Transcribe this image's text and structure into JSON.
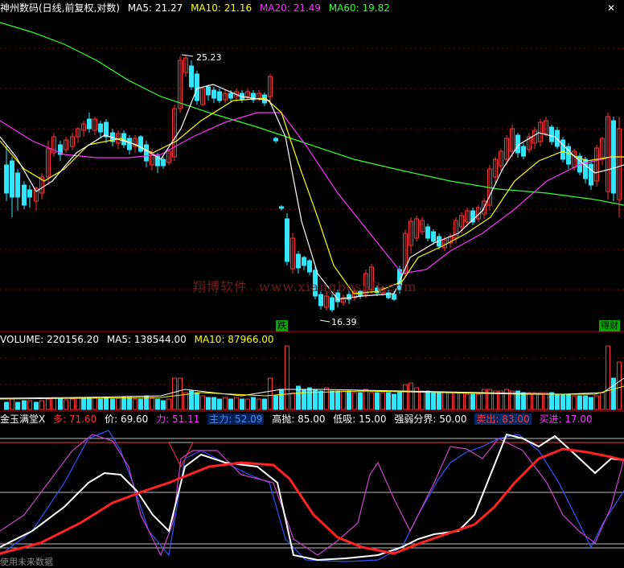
{
  "main_header": {
    "title": "神州数码(日线,前复权,对数)",
    "ma5": "MA5: 21.27",
    "ma10": "MA10: 21.16",
    "ma20": "MA20: 21.49",
    "ma60": "MA60: 19.82"
  },
  "volume_header": {
    "volume": "VOLUME: 220156.20",
    "ma5": "MA5: 138544.00",
    "ma10": "MA10: 87966.00"
  },
  "indicator_header": {
    "name": "金玉满堂X",
    "duo": "多: 71.60",
    "jia": "价: 69.60",
    "li": "力: 51.11",
    "zhuli": "主力: 52.09",
    "gaopao": "高抛: 85.00",
    "dixi": "低吸: 15.00",
    "qiangruo": "强弱分界: 50.00",
    "maichu": "卖出: 83.00",
    "mairu": "买进: 17.00"
  },
  "annotations": {
    "high": "25.23",
    "low": "16.39",
    "tag_die": "跌",
    "tag_cai": "得财"
  },
  "watermark": {
    "text": "翔博软件",
    "url": "www.xiangbosoft.com"
  },
  "footer": "使用未来数据",
  "colors": {
    "up": "#ff3333",
    "down": "#33e6ff",
    "ma5": "#ffffff",
    "ma10": "#ffff00",
    "ma20": "#ff33ff",
    "ma60": "#33ff33",
    "grid": "#8b0000"
  },
  "chart_data": {
    "type": "candlestick",
    "price_extremes": {
      "high": 25.23,
      "low": 16.39
    },
    "panels": [
      "price",
      "volume",
      "indicator"
    ],
    "indicator_levels": [
      85,
      50,
      15
    ],
    "indicator_range": [
      0,
      100
    ]
  }
}
